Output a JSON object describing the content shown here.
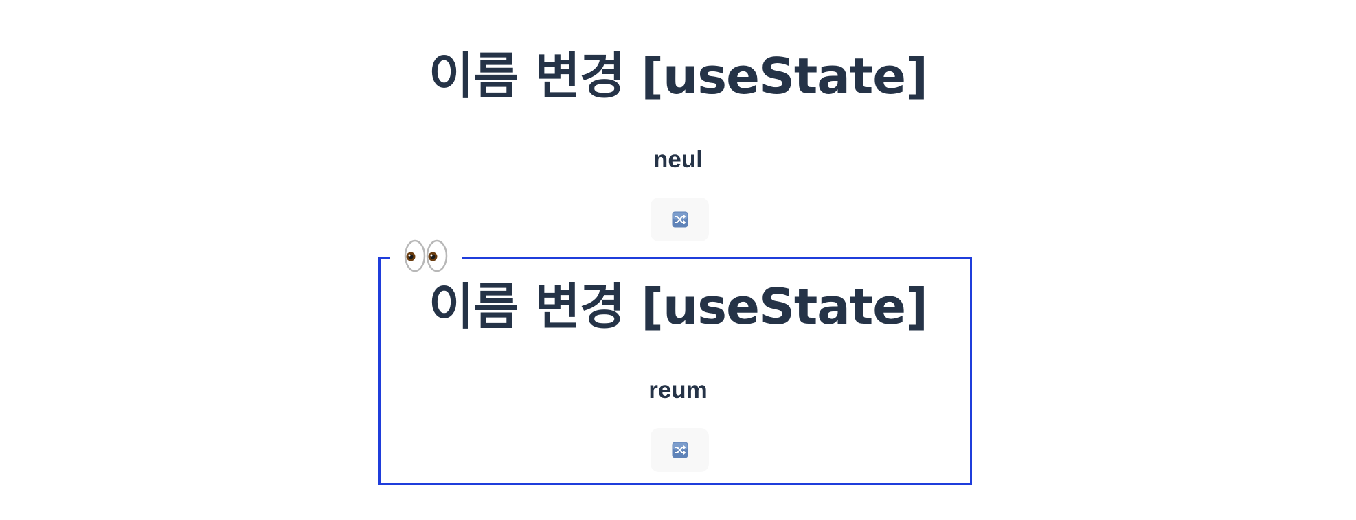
{
  "sections": [
    {
      "title": "이름 변경 [useState]",
      "name": "neul",
      "button_icon": "shuffle-icon"
    },
    {
      "title": "이름 변경 [useState]",
      "name": "reum",
      "button_icon": "shuffle-icon"
    }
  ],
  "highlight": {
    "badge_icon": "eyes-icon",
    "border_color": "#1f3ddb"
  },
  "colors": {
    "text": "#253347",
    "button_bg": "#f8f8f8",
    "icon_bg": "#5f83b8"
  }
}
